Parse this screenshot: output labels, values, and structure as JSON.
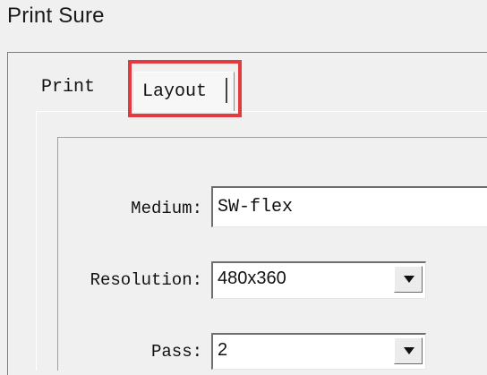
{
  "window": {
    "title": "Print Sure"
  },
  "tabs": [
    {
      "label": "Print",
      "active": false
    },
    {
      "label": "Layout",
      "active": true,
      "highlighted": true
    }
  ],
  "form": {
    "medium": {
      "label": "Medium:",
      "value": "SW-flex"
    },
    "resolution": {
      "label": "Resolution:",
      "value": "480x360",
      "icon": "chevron-down-icon"
    },
    "pass": {
      "label": "Pass:",
      "value": "2",
      "icon": "chevron-down-icon"
    }
  },
  "colors": {
    "highlight": "#e33a3f",
    "background": "#f0f0f0",
    "field": "#ffffff"
  }
}
